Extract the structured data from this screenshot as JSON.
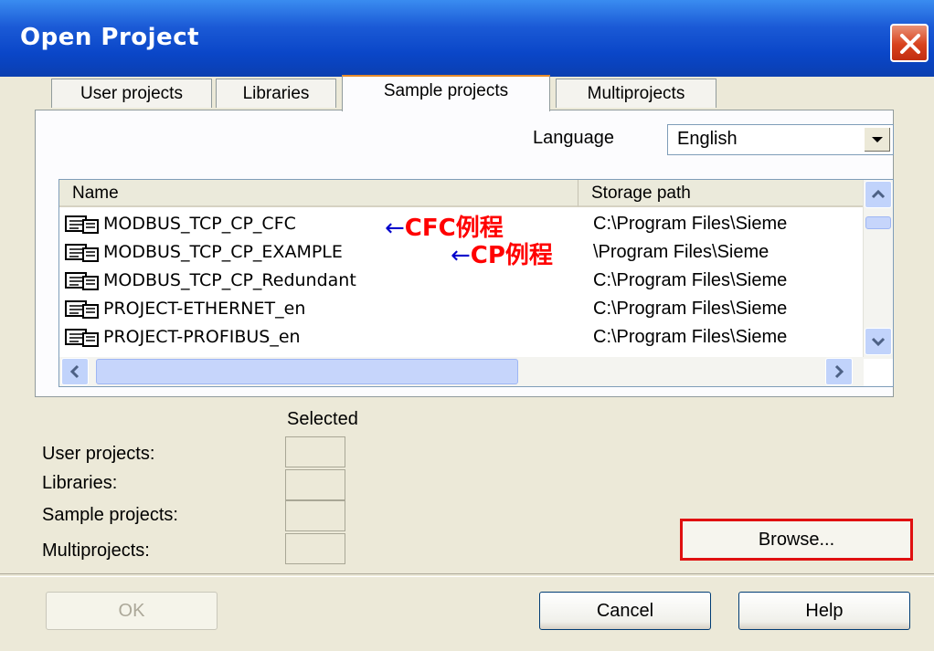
{
  "window": {
    "title": "Open Project"
  },
  "tabs": [
    {
      "label": "User projects",
      "active": false
    },
    {
      "label": "Libraries",
      "active": false
    },
    {
      "label": "Sample projects",
      "active": true
    },
    {
      "label": "Multiprojects",
      "active": false
    }
  ],
  "language": {
    "label": "Language",
    "value": "English"
  },
  "list": {
    "columns": [
      "Name",
      "Storage path"
    ],
    "rows": [
      {
        "name": "MODBUS_TCP_CP_CFC",
        "path": "C:\\Program Files\\Sieme"
      },
      {
        "name": "MODBUS_TCP_CP_EXAMPLE",
        "path": "\\Program Files\\Sieme"
      },
      {
        "name": "MODBUS_TCP_CP_Redundant",
        "path": "C:\\Program Files\\Sieme"
      },
      {
        "name": "PROJECT-ETHERNET_en",
        "path": "C:\\Program Files\\Sieme"
      },
      {
        "name": "PROJECT-PROFIBUS_en",
        "path": "C:\\Program Files\\Sieme"
      }
    ],
    "annotations": [
      {
        "arrow": "←",
        "text": "CFC例程"
      },
      {
        "arrow": "←",
        "text": "CP例程"
      }
    ]
  },
  "selected": {
    "header": "Selected",
    "fields": [
      {
        "label": "User projects:"
      },
      {
        "label": "Libraries:"
      },
      {
        "label": "Sample projects:"
      },
      {
        "label": "Multiprojects:"
      }
    ]
  },
  "buttons": {
    "browse": "Browse...",
    "ok": "OK",
    "cancel": "Cancel",
    "help": "Help"
  },
  "colors": {
    "titlebar": "#0a46c8",
    "dialog_bg": "#ece9d8",
    "annotation": "#ff0000",
    "highlight_box": "#e01010"
  }
}
